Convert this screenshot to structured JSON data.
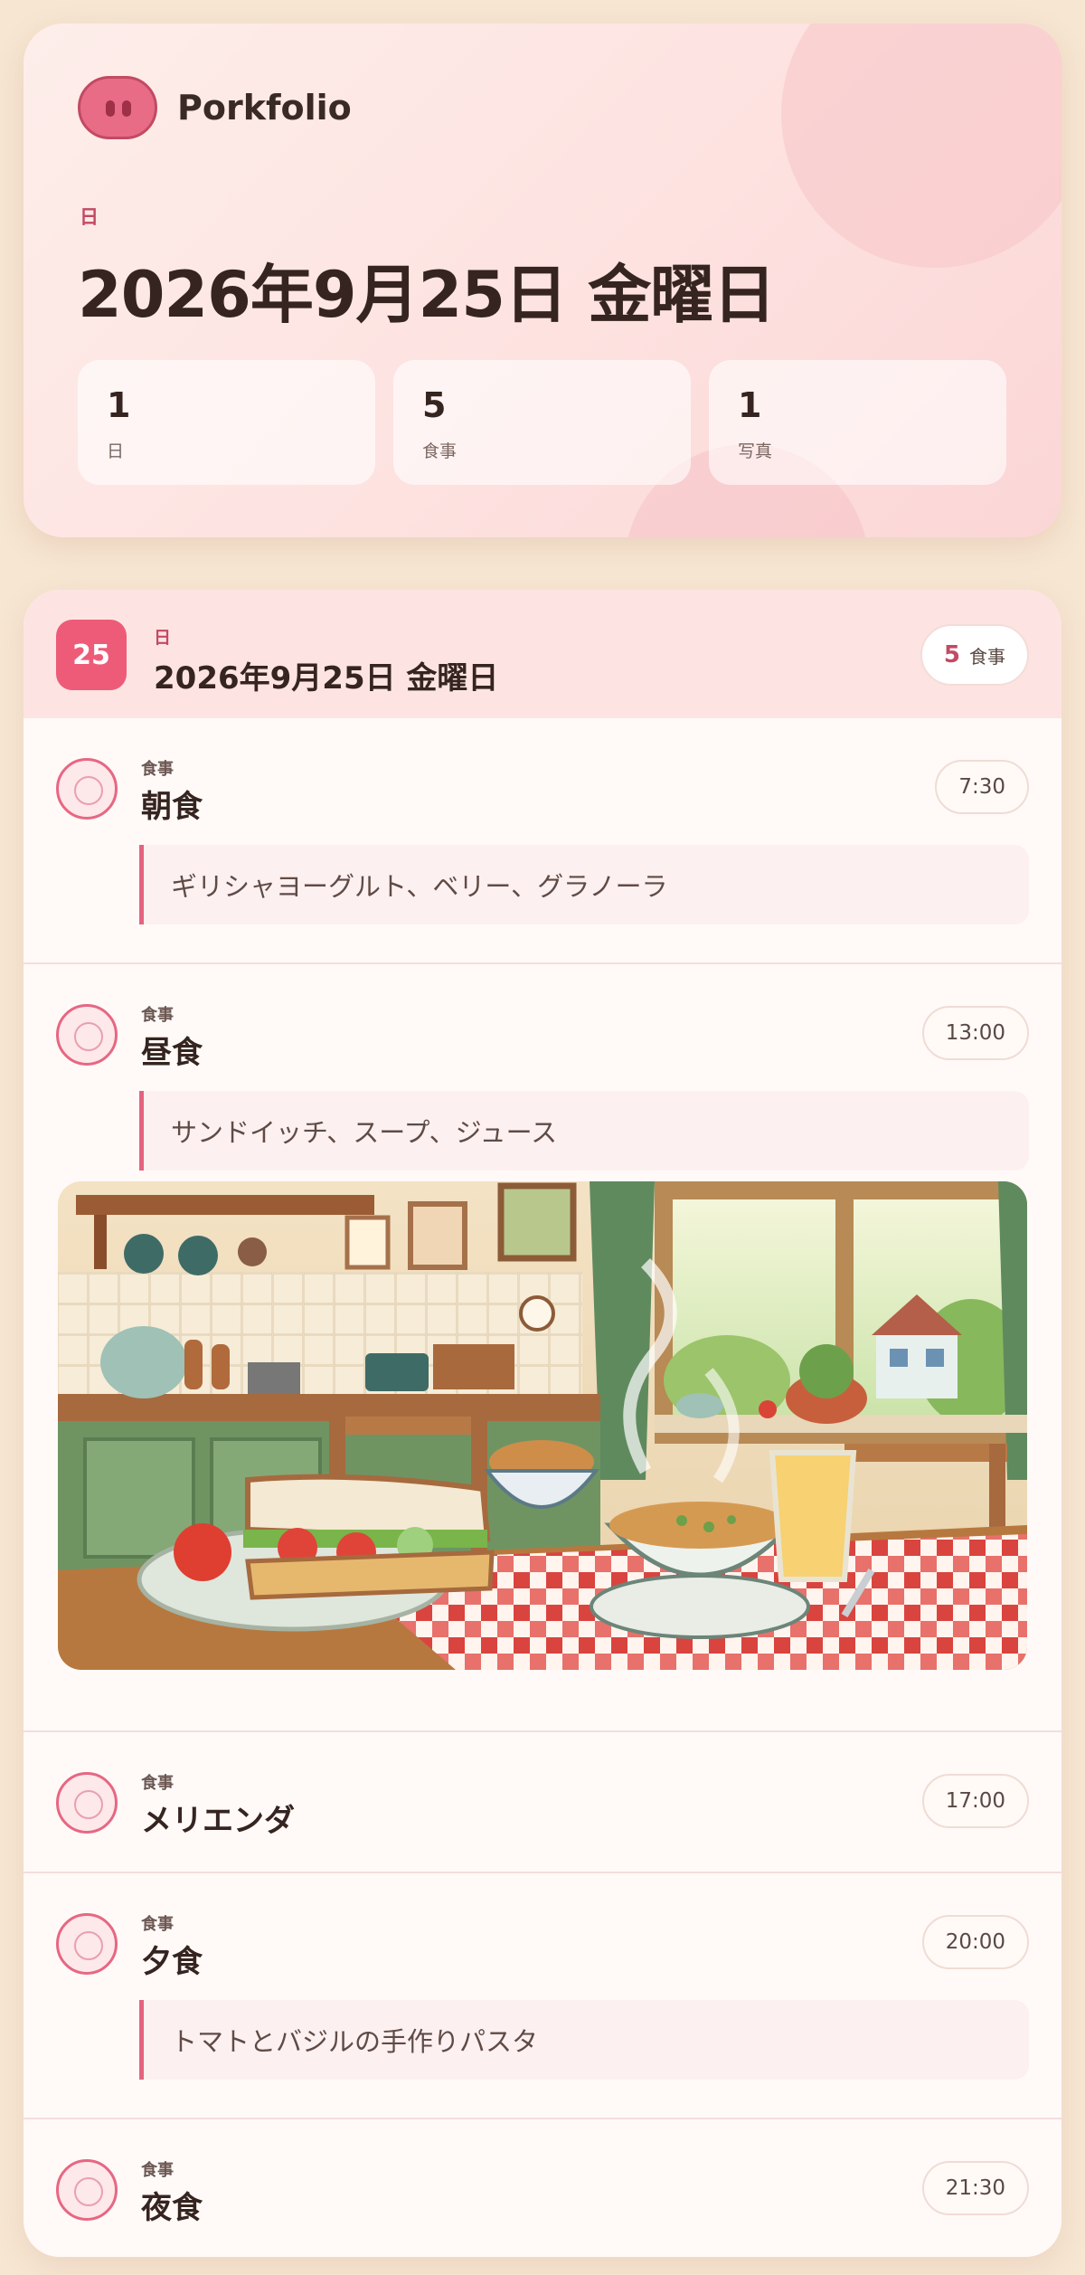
{
  "app": {
    "name": "Porkfolio"
  },
  "summary": {
    "kicker": "日",
    "date_title": "2026年9月25日 金曜日",
    "stats": [
      {
        "value": "1",
        "label": "日"
      },
      {
        "value": "5",
        "label": "食事"
      },
      {
        "value": "1",
        "label": "写真"
      }
    ]
  },
  "day": {
    "badge": "25",
    "kicker": "日",
    "title": "2026年9月25日 金曜日",
    "meal_count": "5",
    "meal_count_label": "食事"
  },
  "meals": [
    {
      "kicker": "食事",
      "name": "朝食",
      "time": "7:30",
      "description": "ギリシャヨーグルト、ベリー、グラノーラ"
    },
    {
      "kicker": "食事",
      "name": "昼食",
      "time": "13:00",
      "description": "サンドイッチ、スープ、ジュース"
    },
    {
      "kicker": "食事",
      "name": "メリエンダ",
      "time": "17:00"
    },
    {
      "kicker": "食事",
      "name": "夕食",
      "time": "20:00",
      "description": "トマトとバジルの手作りパスタ"
    },
    {
      "kicker": "食事",
      "name": "夜食",
      "time": "21:30"
    }
  ],
  "colors": {
    "accent": "#ee5b78",
    "background": "#f6e6d2",
    "card": "#fffaf8"
  },
  "icons": {
    "logo": "pig-snout-icon",
    "meal": "plate-icon"
  }
}
